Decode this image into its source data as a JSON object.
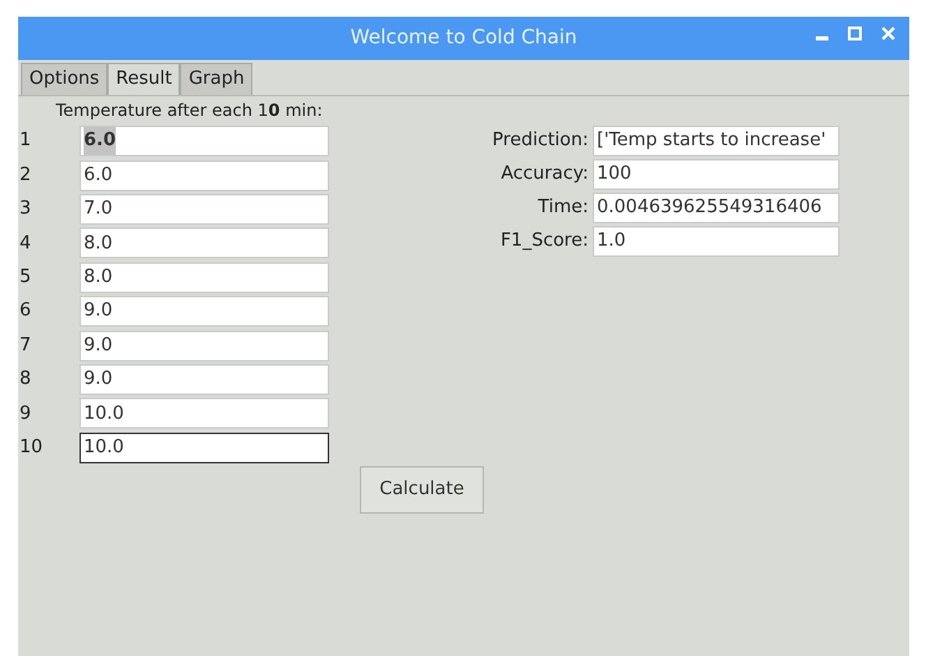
{
  "window": {
    "title": "Welcome to Cold Chain"
  },
  "tabs": [
    {
      "label": "Options",
      "selected": false
    },
    {
      "label": "Result",
      "selected": true
    },
    {
      "label": "Graph",
      "selected": false
    }
  ],
  "temperature_label": "Temperature after each 1**0** min:",
  "readings": [
    {
      "index": "1",
      "value": "6.0",
      "focused": false,
      "text_selected": true
    },
    {
      "index": "2",
      "value": "6.0",
      "focused": false,
      "text_selected": false
    },
    {
      "index": "3",
      "value": "7.0",
      "focused": false,
      "text_selected": false
    },
    {
      "index": "4",
      "value": "8.0",
      "focused": false,
      "text_selected": false
    },
    {
      "index": "5",
      "value": "8.0",
      "focused": false,
      "text_selected": false
    },
    {
      "index": "6",
      "value": "9.0",
      "focused": false,
      "text_selected": false
    },
    {
      "index": "7",
      "value": "9.0",
      "focused": false,
      "text_selected": false
    },
    {
      "index": "8",
      "value": "9.0",
      "focused": false,
      "text_selected": false
    },
    {
      "index": "9",
      "value": "10.0",
      "focused": false,
      "text_selected": false
    },
    {
      "index": "10",
      "value": "10.0",
      "focused": true,
      "text_selected": false
    }
  ],
  "results": [
    {
      "label": "Prediction:",
      "value": "['Temp starts to increase'"
    },
    {
      "label": "Accuracy:",
      "value": "100"
    },
    {
      "label": "Time:",
      "value": "0.004639625549316406"
    },
    {
      "label": "F1_Score:",
      "value": "1.0"
    }
  ],
  "calculate_button": "Calculate"
}
